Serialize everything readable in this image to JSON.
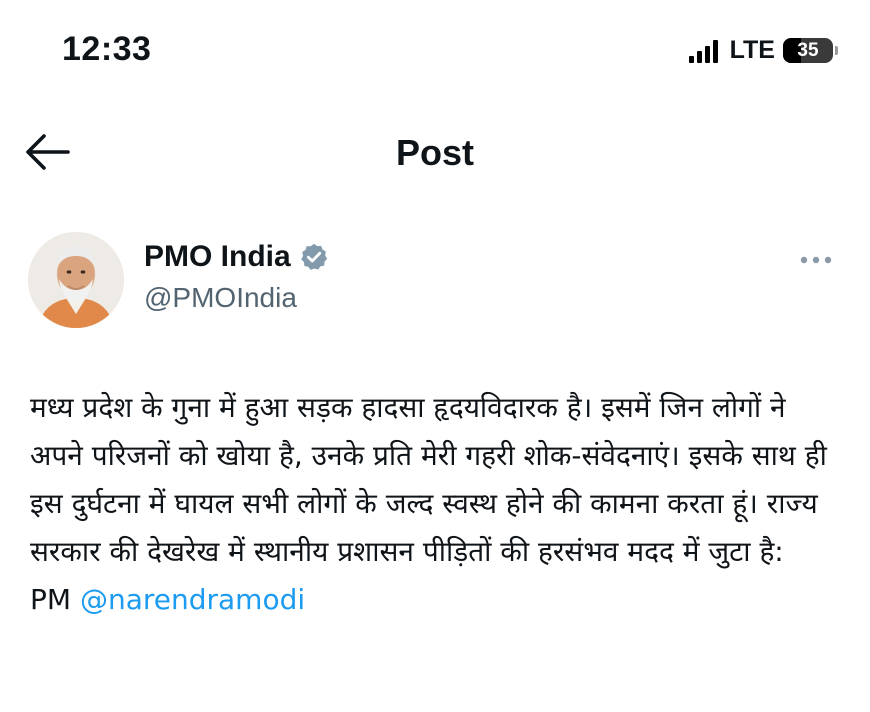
{
  "status_bar": {
    "time": "12:33",
    "network": "LTE",
    "battery_level": "35",
    "battery_fraction": 0.35
  },
  "nav": {
    "title": "Post",
    "back_icon": "arrow-left-icon"
  },
  "post": {
    "author": {
      "name": "PMO India",
      "handle": "@PMOIndia",
      "verified_icon": "verified-badge-icon",
      "avatar_icon": "avatar-image"
    },
    "more_icon": "more-horizontal-icon",
    "text": "मध्य प्रदेश के गुना में हुआ सड़क हादसा हृदयविदारक है। इसमें जिन लोगों ने अपने परिजनों को खोया है, उनके प्रति मेरी गहरी शोक-संवेदनाएं। इसके साथ ही इस दुर्घटना में घायल सभी लोगों के जल्द स्वस्थ होने की कामना करता हूं। राज्य सरकार की देखरेख में स्थानीय प्रशासन पीड़ितों की हरसंभव मदद में जुटा है:",
    "prefix": "PM",
    "mention": "@narendramodi"
  },
  "colors": {
    "text": "#0f1419",
    "secondary_text": "#536471",
    "link": "#1d9bf0",
    "verified_badge": "#829aab"
  }
}
